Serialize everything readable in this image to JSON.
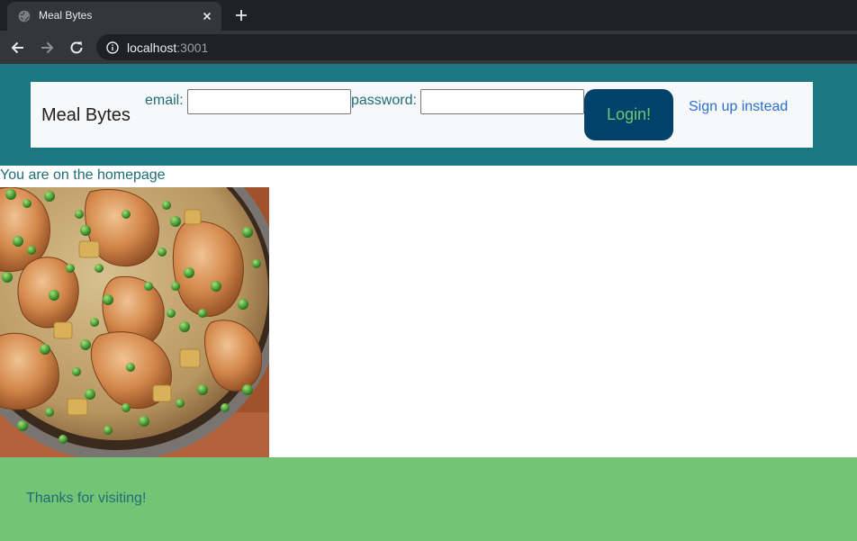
{
  "browser": {
    "tab_title": "Meal Bytes",
    "url_host": "localhost",
    "url_port": ":3001"
  },
  "navbar": {
    "brand": "Meal Bytes",
    "email_label": "email:",
    "email_value": "",
    "password_label": "password:",
    "password_value": "",
    "login_label": "Login!",
    "signup_label": "Sign up instead"
  },
  "main": {
    "home_message": "You are on the homepage",
    "image_icon": "chicken-peas-skillet-photo"
  },
  "footer": {
    "text": "Thanks for visiting!"
  },
  "colors": {
    "header_bg": "#1b7883",
    "navbar_bg": "#f7f8fa",
    "login_bg": "#01426a",
    "login_text": "#74c476",
    "footer_bg": "#74c476",
    "text_teal": "#1f6c77",
    "link_blue": "#2a6fd0"
  }
}
